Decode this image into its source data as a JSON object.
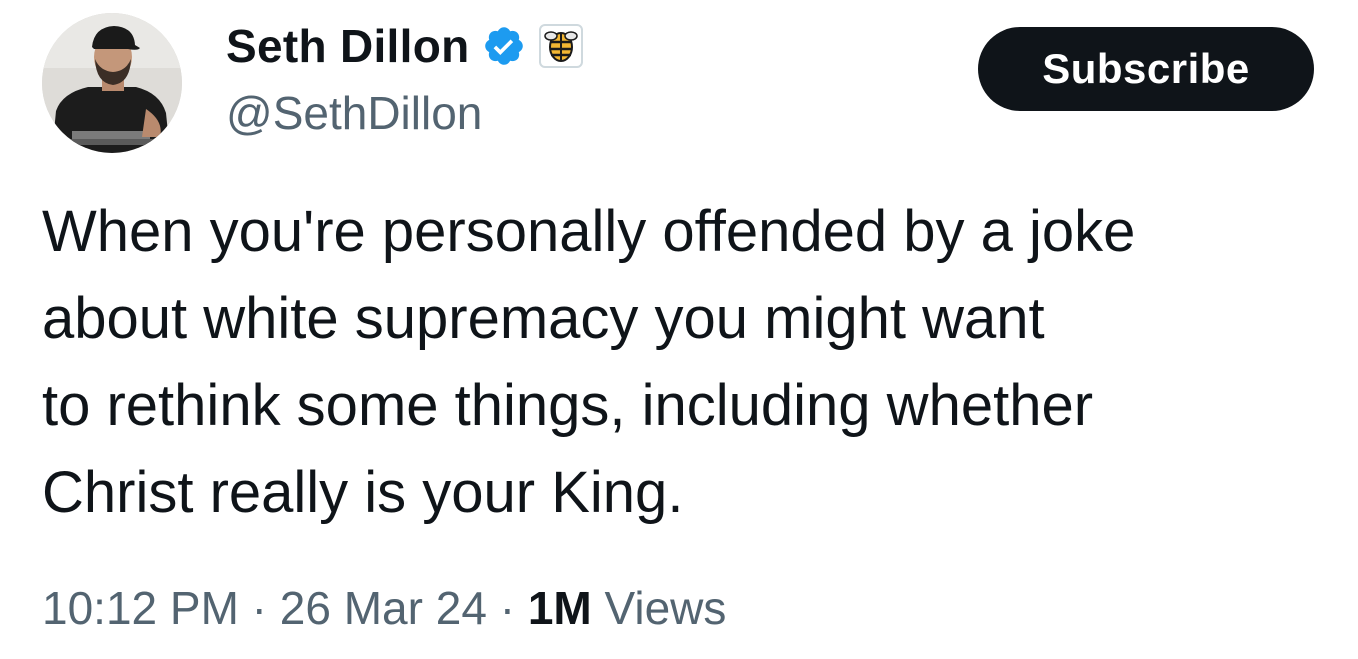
{
  "author": {
    "display_name": "Seth Dillon",
    "handle": "@SethDillon",
    "verified_icon": "verified-badge-icon",
    "affiliate_icon": "babylon-bee-affiliate-icon"
  },
  "subscribe_button": {
    "label": "Subscribe"
  },
  "tweet": {
    "text": "When you're personally offended by a joke\nabout white supremacy you might want\nto rethink some things, including whether\nChrist really is your King."
  },
  "meta": {
    "time": "10:12 PM",
    "separator": " · ",
    "date": "26 Mar 24",
    "views_count": "1M",
    "views_label": " Views"
  },
  "colors": {
    "text_primary": "#0f1419",
    "text_secondary": "#536471",
    "verified_blue": "#1d9bf0",
    "button_bg": "#0f1419"
  }
}
